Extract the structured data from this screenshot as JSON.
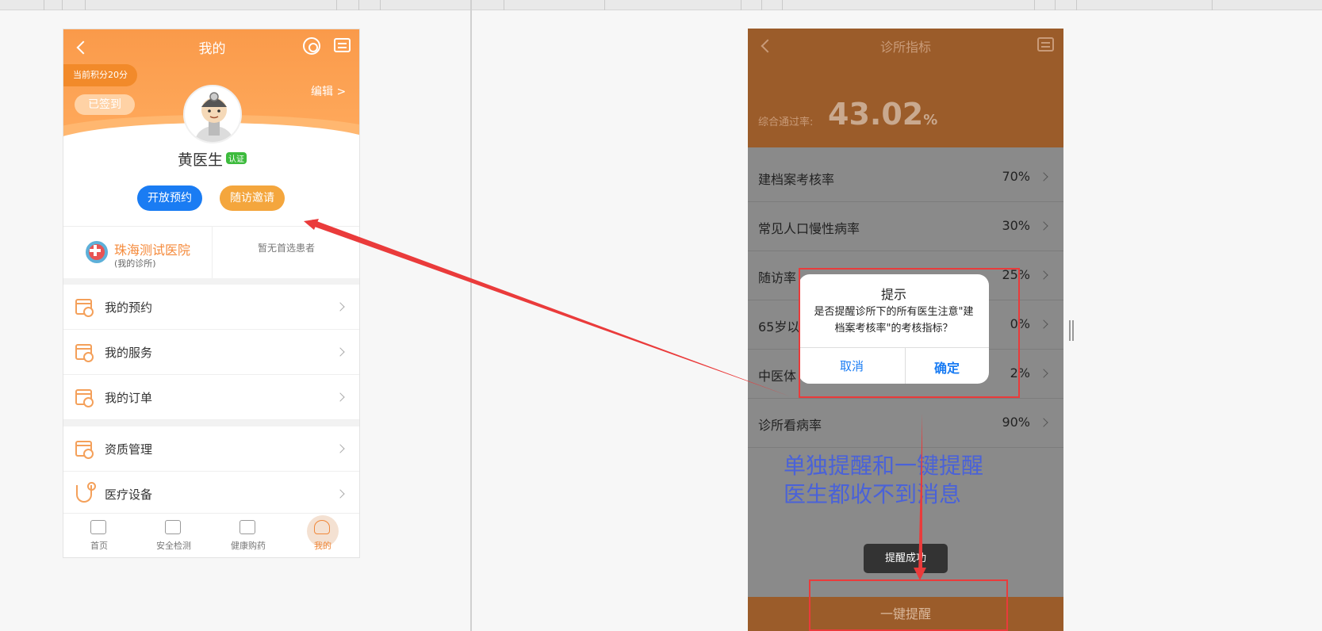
{
  "left_screen": {
    "title": "我的",
    "points": "当前积分20分",
    "signed": "已签到",
    "edit": "编辑 >",
    "doctor_name": "黄医生",
    "verified": "认证",
    "open_appointment": "开放预约",
    "followup_invite": "随访邀请",
    "hospital_name": "珠海测试医院",
    "hospital_sub": "(我的诊所)",
    "no_patient": "暂无首选患者",
    "menu": [
      {
        "label": "我的预约",
        "icon": "calendar-icon"
      },
      {
        "label": "我的服务",
        "icon": "calendar-icon"
      },
      {
        "label": "我的订单",
        "icon": "calendar-icon"
      },
      {
        "label": "资质管理",
        "icon": "calendar-icon"
      },
      {
        "label": "医疗设备",
        "icon": "stethoscope-icon"
      }
    ],
    "tabs": [
      {
        "label": "首页",
        "icon": "home-icon"
      },
      {
        "label": "安全检测",
        "icon": "monitor-icon"
      },
      {
        "label": "健康购药",
        "icon": "medicine-icon"
      },
      {
        "label": "我的",
        "icon": "user-icon",
        "active": true
      }
    ]
  },
  "right_screen": {
    "title": "诊所指标",
    "rate_label": "综合通过率:",
    "rate_value": "43.02",
    "rate_unit": "%",
    "indicators": [
      {
        "label": "建档案考核率",
        "value": "70%"
      },
      {
        "label": "常见人口慢性病率",
        "value": "30%"
      },
      {
        "label": "随访率",
        "value": "25%"
      },
      {
        "label": "65岁以",
        "value": "0%"
      },
      {
        "label": "中医体",
        "value": "2%"
      },
      {
        "label": "诊所看病率",
        "value": "90%"
      }
    ],
    "dialog": {
      "title": "提示",
      "message": "是否提醒诊所下的所有医生注意\"建档案考核率\"的考核指标？",
      "cancel": "取消",
      "confirm": "确定"
    },
    "toast": "提醒成功",
    "bottom_button": "一键提醒"
  },
  "annotation": {
    "note_line1": "单独提醒和一键提醒",
    "note_line2": "医生都收不到消息",
    "color": "#ea3b3b",
    "note_color": "#4a62d8"
  },
  "colors": {
    "orange": "#fa9a4a",
    "blue": "#1a7cf3",
    "brown": "#9b5c2a"
  }
}
